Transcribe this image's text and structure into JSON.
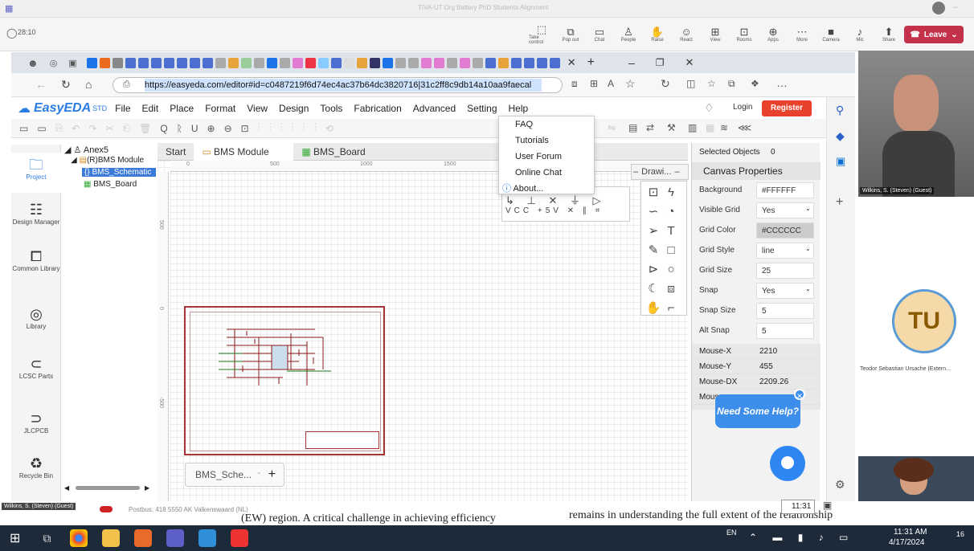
{
  "teams": {
    "title": "TIVA-UT Org Battery PhD Students Alignment",
    "time": "28:10",
    "buttons": [
      {
        "label": "Take control",
        "icon": "screen-icon"
      },
      {
        "label": "Pop out",
        "icon": "popout-icon"
      },
      {
        "label": "Chat",
        "icon": "chat-icon"
      },
      {
        "label": "People",
        "icon": "people-icon"
      },
      {
        "label": "Raise",
        "icon": "hand-icon"
      },
      {
        "label": "React",
        "icon": "smile-icon"
      },
      {
        "label": "View",
        "icon": "grid-icon"
      },
      {
        "label": "Rooms",
        "icon": "rooms-icon"
      },
      {
        "label": "Apps",
        "icon": "apps-icon"
      },
      {
        "label": "More",
        "icon": "more-icon"
      },
      {
        "label": "Camera",
        "icon": "camera-icon"
      },
      {
        "label": "Mic",
        "icon": "mic-icon"
      },
      {
        "label": "Share",
        "icon": "share-icon"
      }
    ],
    "leave": "Leave"
  },
  "browser": {
    "url": "https://easyeda.com/editor#id=c0487219f6d74ec4ac37b64dc3820716|31c2ff8c9db14a10aa9faecal"
  },
  "easyeda": {
    "logo": "EasyEDA",
    "logo_sub": "STD",
    "menu": [
      "File",
      "Edit",
      "Place",
      "Format",
      "View",
      "Design",
      "Tools",
      "Fabrication",
      "Advanced",
      "Setting",
      "Help"
    ],
    "login": "Login",
    "register": "Register",
    "nav": [
      {
        "label": "Project",
        "icon": "folder-icon"
      },
      {
        "label": "Design Manager",
        "icon": "design-manager-icon"
      },
      {
        "label": "Common Library",
        "icon": "common-library-icon"
      },
      {
        "label": "Library",
        "icon": "library-icon"
      },
      {
        "label": "LCSC Parts",
        "icon": "lcsc-icon"
      },
      {
        "label": "JLCPCB",
        "icon": "jlcpcb-icon"
      },
      {
        "label": "Recycle Bin",
        "icon": "recycle-icon"
      }
    ],
    "tree": {
      "root": "Anex5",
      "module": "(R)BMS Module",
      "schematic": "BMS_Schematic",
      "board": "BMS_Board"
    },
    "tabs": [
      "Start",
      "BMS Module",
      "BMS_Board"
    ],
    "ruler_top": [
      "0",
      "500",
      "1000",
      "1500"
    ],
    "ruler_left": [
      "500",
      "0",
      "-500"
    ],
    "help_menu": [
      "FAQ",
      "Tutorials",
      "User Forum",
      "Online Chat",
      "About..."
    ],
    "drawing_title": "Drawi...",
    "sheet_tab": "BMS_Sche...",
    "panel": {
      "selected_label": "Selected Objects",
      "selected_count": "0",
      "title": "Canvas Properties",
      "props": [
        {
          "label": "Background",
          "value": "#FFFFFF"
        },
        {
          "label": "Visible Grid",
          "value": "Yes"
        },
        {
          "label": "Grid Color",
          "value": "#CCCCCC"
        },
        {
          "label": "Grid Style",
          "value": "line"
        },
        {
          "label": "Grid Size",
          "value": "25"
        },
        {
          "label": "Snap",
          "value": "Yes"
        },
        {
          "label": "Snap Size",
          "value": "5"
        },
        {
          "label": "Alt Snap",
          "value": "5"
        }
      ],
      "mouse": [
        {
          "label": "Mouse-X",
          "value": "2210"
        },
        {
          "label": "Mouse-Y",
          "value": "455"
        },
        {
          "label": "Mouse-DX",
          "value": "2209.26"
        },
        {
          "label": "Mous",
          "value": ""
        }
      ]
    },
    "need_help": "Need Some Help?"
  },
  "participants": {
    "p1": "Wilkins, S. (Steven) (Guest)",
    "tu_initials": "TU",
    "tu_name": "Teodor Sebastian Ursache (Extern...",
    "p1_small": "Wilkins, S. (Steven) (Guest)"
  },
  "doc_strip": {
    "line1": "Postbus: 418 5550 AK Valkenswaard (NL)",
    "line2": "(EW) region. A critical challenge in achieving efficiency",
    "line3": "remains in understanding the full extent of the relationship",
    "time": "11:31"
  },
  "taskbar": {
    "lang": "EN",
    "time": "11:31 AM",
    "date": "4/17/2024",
    "notif": "16"
  }
}
